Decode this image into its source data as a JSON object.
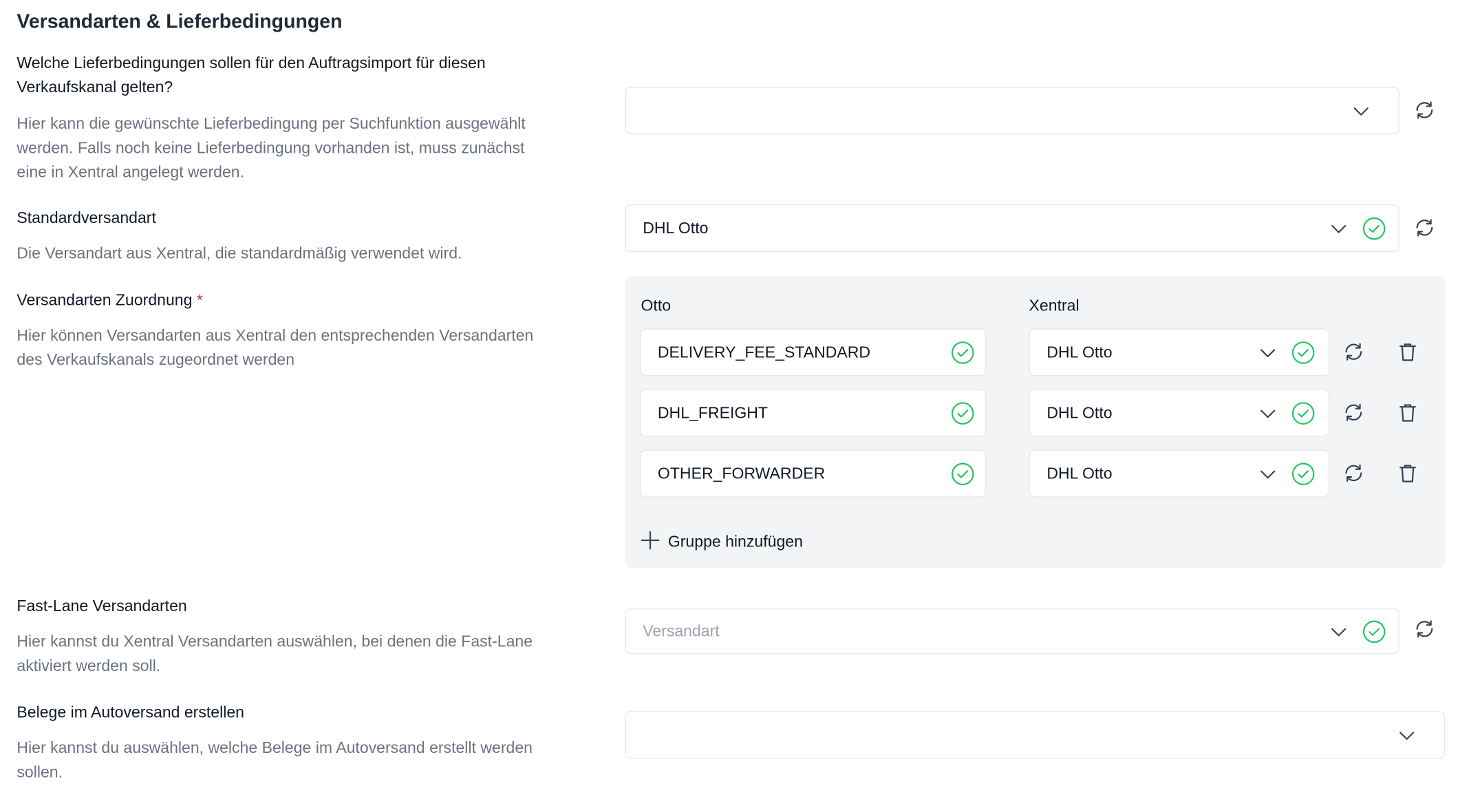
{
  "section_title": "Versandarten & Lieferbedingungen",
  "delivery_terms": {
    "question": "Welche Lieferbedingungen sollen für den Auftragsimport für diesen Verkaufskanal gelten?",
    "question_line1": "Welche Lieferbedingungen sollen für den Auftragsimport für diesen",
    "question_line2": "Verkaufskanal gelten?",
    "desc_line1": "Hier kann die gewünschte Lieferbedingung per Suchfunktion ausgewählt",
    "desc_line2": "werden. Falls noch keine Lieferbedingung vorhanden ist, muss zunächst",
    "desc_line3": "eine in Xentral angelegt werden.",
    "value": ""
  },
  "default_shipping": {
    "label": "Standardversandart",
    "desc": "Die Versandart aus Xentral, die standardmäßig verwendet wird.",
    "value": "DHL Otto"
  },
  "mapping": {
    "label": "Versandarten Zuordnung",
    "required_mark": "*",
    "desc_line1": "Hier können Versandarten aus Xentral den entsprechenden Versandarten",
    "desc_line2": "des Verkaufskanals zugeordnet werden",
    "col_left": "Otto",
    "col_right": "Xentral",
    "rows": [
      {
        "otto": "DELIVERY_FEE_STANDARD",
        "xentral": "DHL Otto"
      },
      {
        "otto": "DHL_FREIGHT",
        "xentral": "DHL Otto"
      },
      {
        "otto": "OTHER_FORWARDER",
        "xentral": "DHL Otto"
      }
    ],
    "add_group": "Gruppe hinzufügen"
  },
  "fast_lane": {
    "label": "Fast-Lane Versandarten",
    "desc_line1": "Hier kannst du Xentral Versandarten auswählen, bei denen die Fast-Lane",
    "desc_line2": "aktiviert werden soll.",
    "placeholder": "Versandart"
  },
  "autoversand": {
    "label": "Belege im Autoversand erstellen",
    "desc_line1": "Hier kannst du auswählen, welche Belege im Autoversand erstellt werden",
    "desc_line2": "sollen.",
    "value": ""
  },
  "colors": {
    "check": "#22c55e",
    "text": "#111827",
    "muted": "#6b7280",
    "required": "#dc2626",
    "panel": "#f3f4f6"
  }
}
